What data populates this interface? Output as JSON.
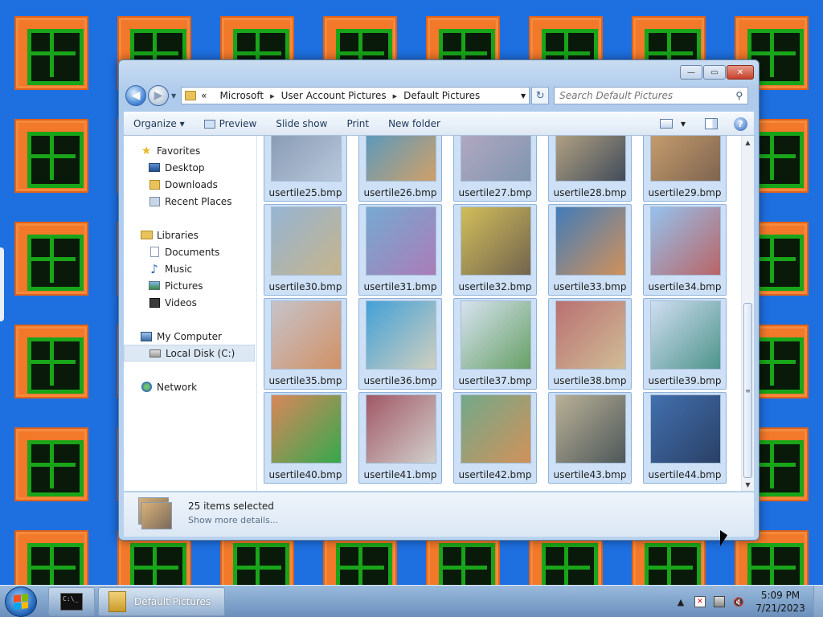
{
  "window": {
    "controls": {
      "minimize": "—",
      "maximize": "▭",
      "close": "✕"
    },
    "nav": {
      "back_glyph": "◀",
      "forward_glyph": "▶",
      "history_glyph": "▼"
    },
    "address": {
      "prefix": "«",
      "crumbs": [
        "Microsoft",
        "User Account Pictures",
        "Default Pictures"
      ],
      "separator": "▸",
      "dropdown_glyph": "▼",
      "refresh_glyph": "↻"
    },
    "search": {
      "placeholder": "Search Default Pictures",
      "icon": "search-icon"
    },
    "toolbar": {
      "organize": "Organize ▾",
      "preview": "Preview",
      "slideshow": "Slide show",
      "print": "Print",
      "new_folder": "New folder",
      "view_drop": "▾",
      "help": "?"
    },
    "sidebar": {
      "favorites": {
        "label": "Favorites",
        "items": [
          "Desktop",
          "Downloads",
          "Recent Places"
        ]
      },
      "libraries": {
        "label": "Libraries",
        "items": [
          "Documents",
          "Music",
          "Pictures",
          "Videos"
        ]
      },
      "computer": {
        "label": "My Computer",
        "items": [
          "Local Disk (C:)"
        ]
      },
      "network": {
        "label": "Network"
      }
    },
    "files": [
      {
        "name": "usertile25.bmp",
        "colors": [
          "#7d8a98",
          "#c7ced6"
        ]
      },
      {
        "name": "usertile26.bmp",
        "colors": [
          "#2f8fc2",
          "#e79a3c"
        ]
      },
      {
        "name": "usertile27.bmp",
        "colors": [
          "#c9a9b7",
          "#7d8b9a"
        ]
      },
      {
        "name": "usertile28.bmp",
        "colors": [
          "#d9b06a",
          "#2a2a2a"
        ]
      },
      {
        "name": "usertile29.bmp",
        "colors": [
          "#e9a24a",
          "#7a4a1c"
        ]
      },
      {
        "name": "usertile30.bmp",
        "colors": [
          "#9ab6cc",
          "#d9b36a"
        ]
      },
      {
        "name": "usertile31.bmp",
        "colors": [
          "#6fa6c8",
          "#b46aa6"
        ]
      },
      {
        "name": "usertile32.bmp",
        "colors": [
          "#e8c12a",
          "#6a4a1a"
        ]
      },
      {
        "name": "usertile33.bmp",
        "colors": [
          "#2a6aa8",
          "#e8862a"
        ]
      },
      {
        "name": "usertile34.bmp",
        "colors": [
          "#9ac6ee",
          "#c84a3a"
        ]
      },
      {
        "name": "usertile35.bmp",
        "colors": [
          "#d9c9c0",
          "#e8863a"
        ]
      },
      {
        "name": "usertile36.bmp",
        "colors": [
          "#2a9ad0",
          "#e8d9b0"
        ]
      },
      {
        "name": "usertile37.bmp",
        "colors": [
          "#f2f2f2",
          "#5a9a3a"
        ]
      },
      {
        "name": "usertile38.bmp",
        "colors": [
          "#c85a4a",
          "#e8c07a"
        ]
      },
      {
        "name": "usertile39.bmp",
        "colors": [
          "#e6ecf3",
          "#3a8a6a"
        ]
      },
      {
        "name": "usertile40.bmp",
        "colors": [
          "#f2782a",
          "#19a519"
        ]
      },
      {
        "name": "usertile41.bmp",
        "colors": [
          "#a83a3a",
          "#e8d9c0"
        ]
      },
      {
        "name": "usertile42.bmp",
        "colors": [
          "#6aa66a",
          "#e8862a"
        ]
      },
      {
        "name": "usertile43.bmp",
        "colors": [
          "#c8b07a",
          "#3a3a2a"
        ]
      },
      {
        "name": "usertile44.bmp",
        "colors": [
          "#2a5a9a",
          "#0a1a3a"
        ]
      }
    ],
    "details": {
      "count": "25 items selected",
      "more": "Show more details..."
    }
  },
  "taskbar": {
    "cmd_icon_text": "C:\\_",
    "active_window_label": "Default Pictures",
    "tray": {
      "expand": "▲"
    },
    "clock": {
      "time": "5:09 PM",
      "date": "7/21/2023"
    }
  }
}
